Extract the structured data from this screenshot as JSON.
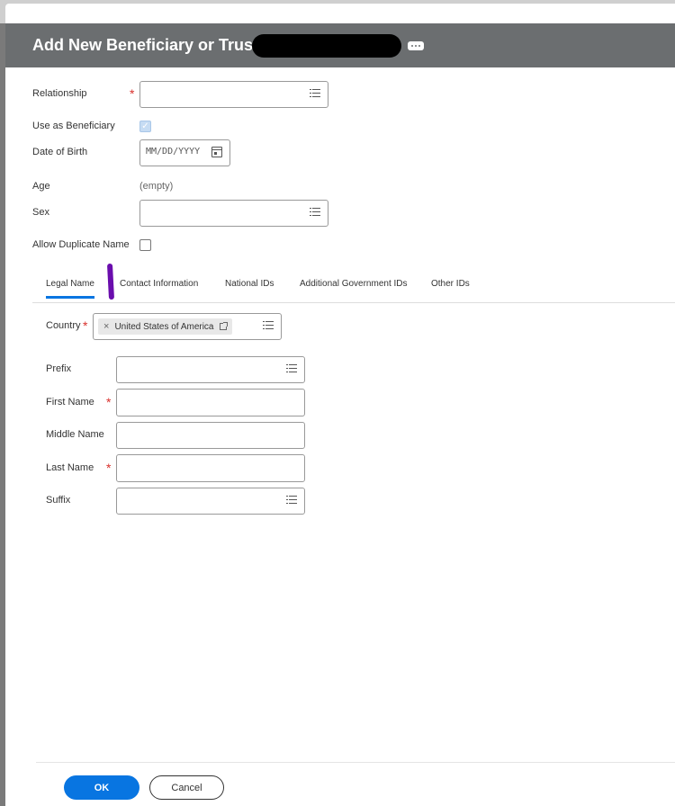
{
  "dialog": {
    "title": "Add New Beneficiary or Trust"
  },
  "form": {
    "relationship_label": "Relationship",
    "use_as_beneficiary_label": "Use as Beneficiary",
    "date_of_birth_label": "Date of Birth",
    "date_placeholder": "MM/DD/YYYY",
    "age_label": "Age",
    "age_value": "(empty)",
    "sex_label": "Sex",
    "allow_duplicate_label": "Allow Duplicate Name"
  },
  "tabs": [
    {
      "label": "Legal Name"
    },
    {
      "label": "Contact Information"
    },
    {
      "label": "National IDs"
    },
    {
      "label": "Additional Government IDs"
    },
    {
      "label": "Other IDs"
    }
  ],
  "legal_name": {
    "country_label": "Country",
    "country_value": "United States of America",
    "prefix_label": "Prefix",
    "first_name_label": "First Name",
    "middle_name_label": "Middle Name",
    "last_name_label": "Last Name",
    "suffix_label": "Suffix"
  },
  "footer": {
    "ok_label": "OK",
    "cancel_label": "Cancel"
  },
  "colors": {
    "header_bg": "#6b6e70",
    "primary": "#0875e1",
    "required": "#d9302c"
  }
}
